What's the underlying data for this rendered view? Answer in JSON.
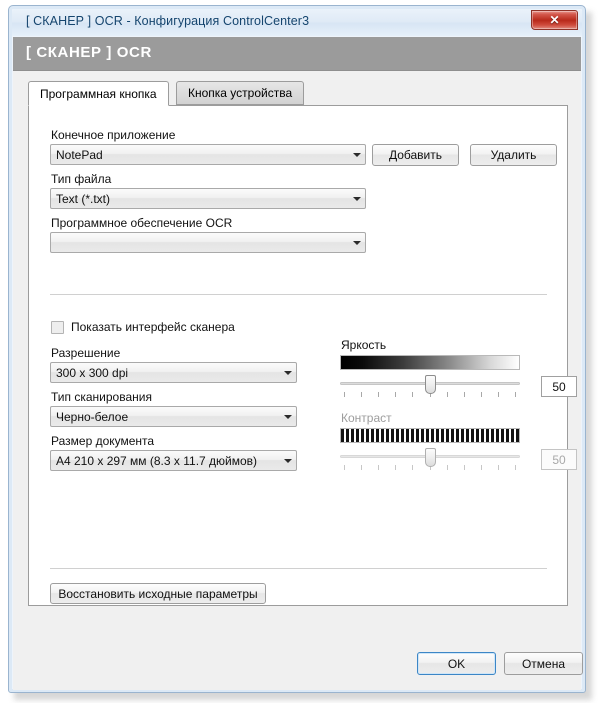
{
  "window": {
    "title": "[ СКАНЕР ]  OCR - Конфигурация ControlCenter3",
    "close_glyph": "✕",
    "accent_blue": "#3c86c6",
    "header_band_color": "#9b9b9b",
    "close_button_color": "#b8291b"
  },
  "app_header": {
    "title": "[ СКАНЕР ]  OCR"
  },
  "tabs": [
    {
      "label": "Программная кнопка",
      "active": true
    },
    {
      "label": "Кнопка устройства",
      "active": false
    }
  ],
  "form": {
    "target_app": {
      "label": "Конечное приложение",
      "value": "NotePad"
    },
    "file_type": {
      "label": "Тип файла",
      "value": "Text (*.txt)"
    },
    "ocr_software": {
      "label": "Программное обеспечение OCR",
      "value": ""
    },
    "add_button": "Добавить",
    "delete_button": "Удалить",
    "show_scanner_ui": {
      "label": "Показать интерфейс сканера",
      "checked": false
    },
    "resolution": {
      "label": "Разрешение",
      "value": "300 x 300 dpi"
    },
    "scan_type": {
      "label": "Тип сканирования",
      "value": "Черно-белое"
    },
    "document_size": {
      "label": "Размер документа",
      "value": "A4 210 x 297 мм (8.3 x 11.7 дюймов)"
    },
    "brightness": {
      "label": "Яркость",
      "value": "50",
      "enabled": true,
      "percent": 50,
      "tick_count": 11
    },
    "contrast": {
      "label": "Контраст",
      "value": "50",
      "enabled": false,
      "percent": 50,
      "tick_count": 11
    },
    "restore_defaults_button": "Восстановить исходные параметры"
  },
  "footer": {
    "ok_button": "OK",
    "cancel_button": "Отмена"
  }
}
